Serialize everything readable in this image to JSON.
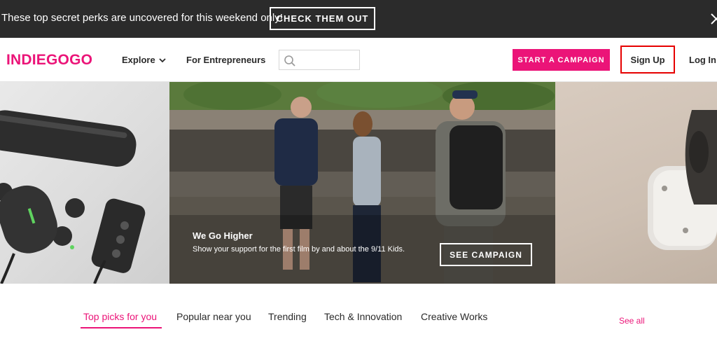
{
  "promo": {
    "text": "These top secret perks are uncovered for this weekend only!",
    "button_label": "CHECK THEM OUT",
    "close_icon": "close-icon"
  },
  "header": {
    "logo": "INDIEGOGO",
    "nav": {
      "explore_label": "Explore",
      "explore_icon": "chevron-down-icon",
      "entrepreneurs_label": "For Entrepreneurs"
    },
    "search": {
      "icon": "search-icon",
      "value": "",
      "placeholder": ""
    },
    "start_campaign_label": "START A CAMPAIGN",
    "signup_label": "Sign Up",
    "login_label": "Log In"
  },
  "hero": {
    "title": "We Go Higher",
    "description": "Show your support for the first film by and about the 9/11 Kids.",
    "button_label": "SEE CAMPAIGN"
  },
  "tabs": {
    "items": [
      {
        "label": "Top picks for you",
        "active": true
      },
      {
        "label": "Popular near you",
        "active": false
      },
      {
        "label": "Trending",
        "active": false
      },
      {
        "label": "Tech & Innovation",
        "active": false
      },
      {
        "label": "Creative Works",
        "active": false
      }
    ],
    "see_all_label": "See all"
  },
  "colors": {
    "brand": "#eb1478",
    "banner_bg": "#2b2b2b",
    "highlight_border": "#e60000",
    "text": "#2a2a2a"
  }
}
